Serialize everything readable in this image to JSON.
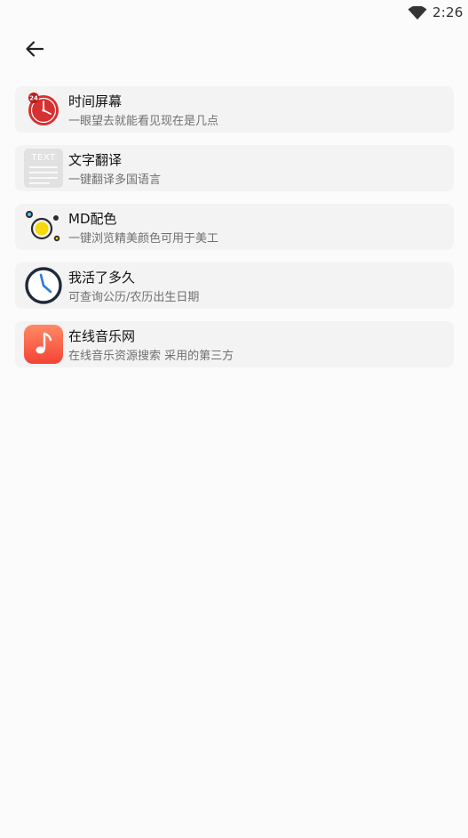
{
  "status_bar": {
    "time": "2:26",
    "icons": [
      "wifi-icon"
    ]
  },
  "header": {
    "back_icon": "arrow-left-icon"
  },
  "items": [
    {
      "title": "时间屏幕",
      "subtitle": "一眼望去就能看见现在是几点",
      "icon": "red-clock-icon",
      "icon_badge": "24"
    },
    {
      "title": "文字翻译",
      "subtitle": "一键翻译多国语言",
      "icon": "text-document-icon",
      "icon_text": "TEXT"
    },
    {
      "title": "MD配色",
      "subtitle": "一键浏览精美颜色可用于美工",
      "icon": "color-orbit-icon"
    },
    {
      "title": "我活了多久",
      "subtitle": "可查询公历/农历出生日期",
      "icon": "clock-outline-icon"
    },
    {
      "title": "在线音乐网",
      "subtitle": "在线音乐资源搜索 采用的第三方",
      "icon": "music-note-icon"
    }
  ],
  "colors": {
    "background": "#fbfbfb",
    "card": "#f3f3f3",
    "clock_red": "#d63031",
    "music_gradient_start": "#ff8a65",
    "music_gradient_end": "#f44336",
    "clock_outline": "#1f2a3a",
    "clock_hand": "#2e7bd6",
    "orbit_yellow": "#f5d90a"
  }
}
